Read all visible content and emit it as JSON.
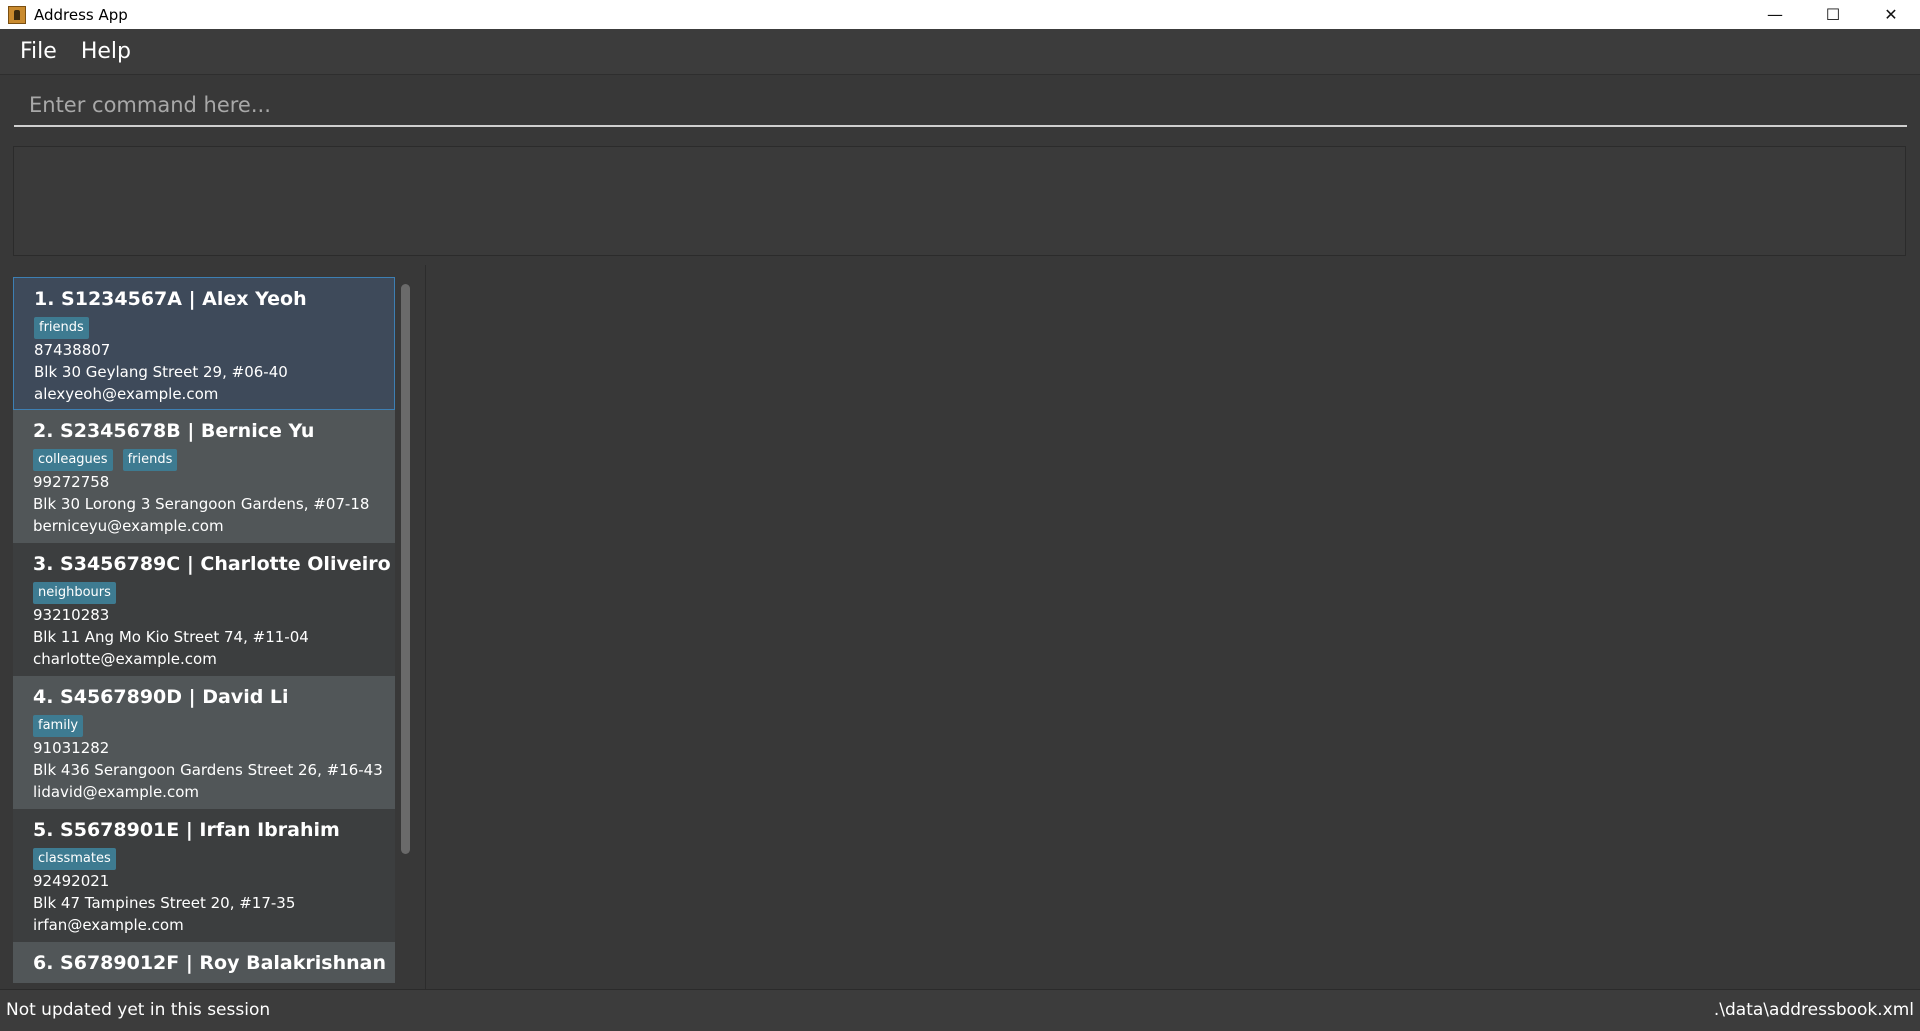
{
  "window": {
    "title": "Address App",
    "minimize_glyph": "—",
    "maximize_glyph": "☐",
    "close_glyph": "✕"
  },
  "menu": {
    "file": "File",
    "help": "Help"
  },
  "command": {
    "placeholder": "Enter command here...",
    "value": ""
  },
  "result": {
    "text": ""
  },
  "persons": [
    {
      "header": "1.  S1234567A | Alex Yeoh",
      "tags": [
        "friends"
      ],
      "phone": "87438807",
      "address": "Blk 30 Geylang Street 29, #06-40",
      "email": "alexyeoh@example.com"
    },
    {
      "header": "2.  S2345678B | Bernice Yu",
      "tags": [
        "colleagues",
        "friends"
      ],
      "phone": "99272758",
      "address": "Blk 30 Lorong 3 Serangoon Gardens, #07-18",
      "email": "berniceyu@example.com"
    },
    {
      "header": "3.  S3456789C | Charlotte Oliveiro",
      "tags": [
        "neighbours"
      ],
      "phone": "93210283",
      "address": "Blk 11 Ang Mo Kio Street 74, #11-04",
      "email": "charlotte@example.com"
    },
    {
      "header": "4.  S4567890D | David Li",
      "tags": [
        "family"
      ],
      "phone": "91031282",
      "address": "Blk 436 Serangoon Gardens Street 26, #16-43",
      "email": "lidavid@example.com"
    },
    {
      "header": "5.  S5678901E | Irfan Ibrahim",
      "tags": [
        "classmates"
      ],
      "phone": "92492021",
      "address": "Blk 47 Tampines Street 20, #17-35",
      "email": "irfan@example.com"
    },
    {
      "header": "6.  S6789012F | Roy Balakrishnan",
      "tags": [],
      "phone": "",
      "address": "",
      "email": ""
    }
  ],
  "status": {
    "sync": "Not updated yet in this session",
    "path": ".\\data\\addressbook.xml"
  },
  "colors": {
    "background": "#383838",
    "tag": "#3e7b91",
    "selected_border": "#3d7fb3"
  }
}
